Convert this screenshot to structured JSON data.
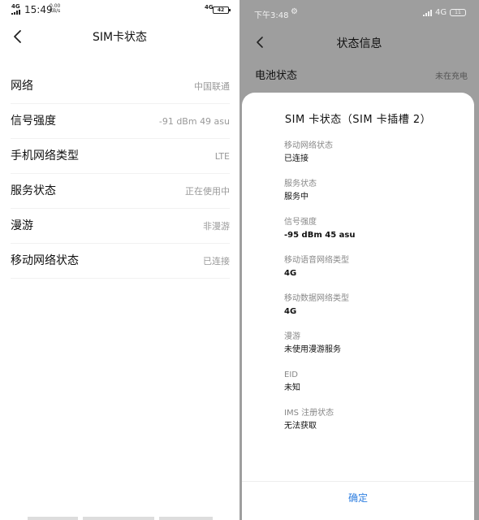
{
  "left_phone": {
    "status_bar": {
      "signal_label": "4G",
      "time": "15:49",
      "speed_value": "0.00",
      "speed_unit": "KB/s",
      "net_label": "4G",
      "battery": "42"
    },
    "header": {
      "title": "SIM卡状态"
    },
    "rows": [
      {
        "label": "网络",
        "value": "中国联通"
      },
      {
        "label": "信号强度",
        "value": "-91 dBm   49 asu"
      },
      {
        "label": "手机网络类型",
        "value": "LTE"
      },
      {
        "label": "服务状态",
        "value": "正在使用中"
      },
      {
        "label": "漫游",
        "value": "非漫游"
      },
      {
        "label": "移动网络状态",
        "value": "已连接"
      }
    ]
  },
  "right_phone": {
    "status_bar": {
      "time": "下午3:48",
      "net_label": "4G",
      "battery": "11"
    },
    "header": {
      "title": "状态信息"
    },
    "battery_row": {
      "label": "电池状态",
      "value": "未在充电"
    },
    "dialog": {
      "title": "SIM 卡状态（SIM 卡插槽 2）",
      "items": [
        {
          "label": "移动网络状态",
          "value": "已连接"
        },
        {
          "label": "服务状态",
          "value": "服务中"
        },
        {
          "label": "信号强度",
          "value": "-95 dBm 45 asu"
        },
        {
          "label": "移动语音网络类型",
          "value": "4G"
        },
        {
          "label": "移动数据网络类型",
          "value": "4G"
        },
        {
          "label": "漫游",
          "value": "未使用漫游服务"
        },
        {
          "label": "EID",
          "value": "未知"
        },
        {
          "label": "IMS 注册状态",
          "value": "无法获取"
        }
      ],
      "ok_label": "确定"
    }
  },
  "colors": {
    "accent": "#2f7fe0",
    "overlay": "#9e9e9e",
    "muted_text": "#999999"
  }
}
